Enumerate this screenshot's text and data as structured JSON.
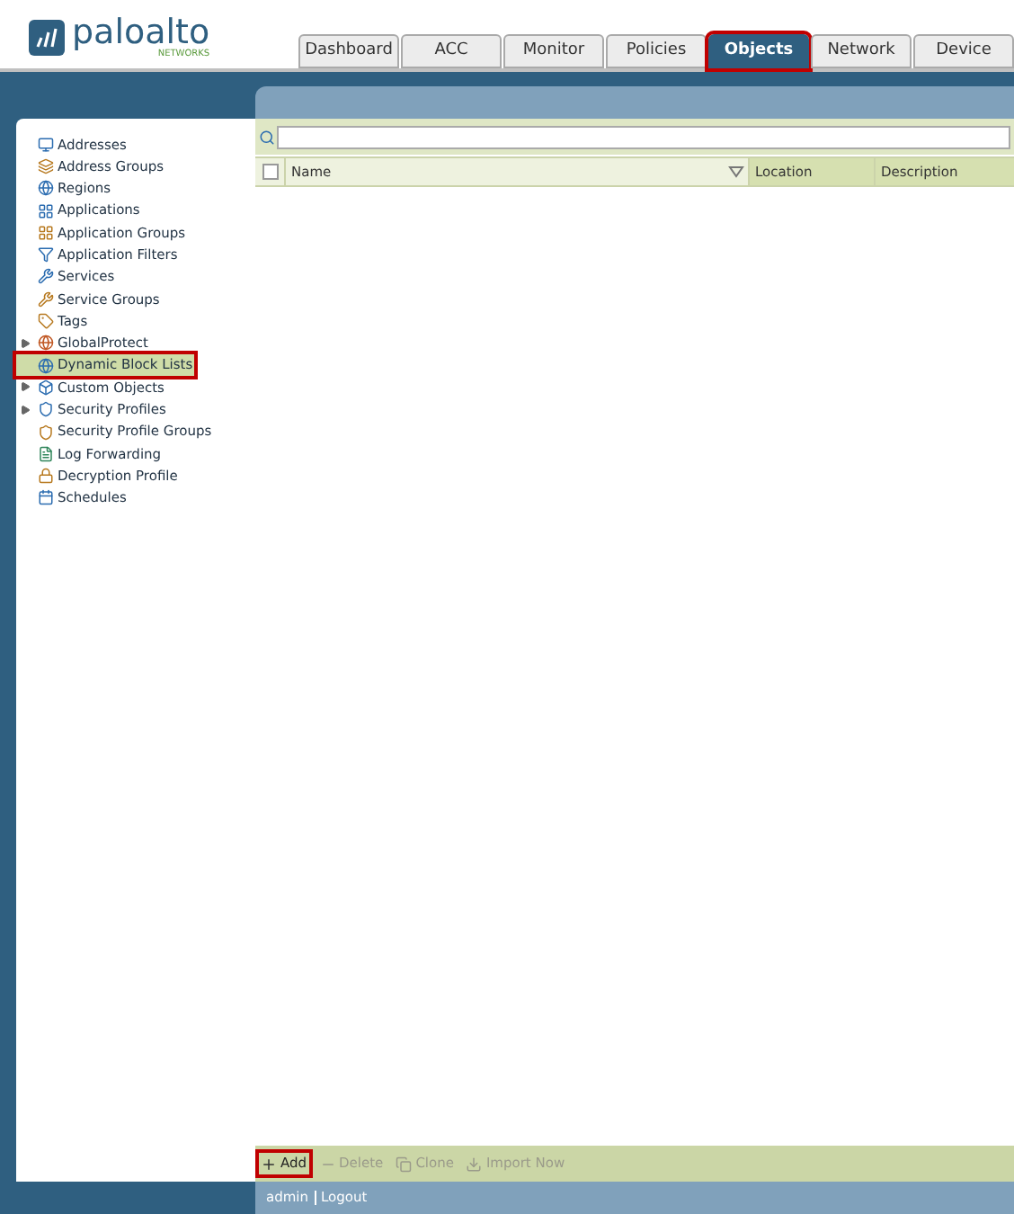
{
  "logo": {
    "name": "paloalto",
    "sub": "NETWORKS"
  },
  "tabs": [
    {
      "label": "Dashboard",
      "selected": false,
      "highlighted": false
    },
    {
      "label": "ACC",
      "selected": false,
      "highlighted": false
    },
    {
      "label": "Monitor",
      "selected": false,
      "highlighted": false
    },
    {
      "label": "Policies",
      "selected": false,
      "highlighted": false
    },
    {
      "label": "Objects",
      "selected": true,
      "highlighted": true
    },
    {
      "label": "Network",
      "selected": false,
      "highlighted": false
    },
    {
      "label": "Device",
      "selected": false,
      "highlighted": false
    }
  ],
  "sidebar": {
    "items": [
      {
        "label": "Addresses",
        "kind": "item",
        "selected": false,
        "highlighted": false
      },
      {
        "label": "Address Groups",
        "kind": "item",
        "selected": false,
        "highlighted": false
      },
      {
        "label": "Regions",
        "kind": "item",
        "selected": false,
        "highlighted": false
      },
      {
        "label": "Applications",
        "kind": "item",
        "selected": false,
        "highlighted": false
      },
      {
        "label": "Application Groups",
        "kind": "item",
        "selected": false,
        "highlighted": false
      },
      {
        "label": "Application Filters",
        "kind": "item",
        "selected": false,
        "highlighted": false
      },
      {
        "label": "Services",
        "kind": "item",
        "selected": false,
        "highlighted": false
      },
      {
        "label": "Service Groups",
        "kind": "item",
        "selected": false,
        "highlighted": false
      },
      {
        "label": "Tags",
        "kind": "item",
        "selected": false,
        "highlighted": false
      },
      {
        "label": "GlobalProtect",
        "kind": "folder",
        "expanded": false,
        "selected": false,
        "highlighted": false
      },
      {
        "label": "Dynamic Block Lists",
        "kind": "item",
        "selected": true,
        "highlighted": true
      },
      {
        "label": "Custom Objects",
        "kind": "folder",
        "expanded": false,
        "selected": false,
        "highlighted": false
      },
      {
        "label": "Security Profiles",
        "kind": "folder",
        "expanded": false,
        "selected": false,
        "highlighted": false
      },
      {
        "label": "Security Profile Groups",
        "kind": "item",
        "selected": false,
        "highlighted": false
      },
      {
        "label": "Log Forwarding",
        "kind": "item",
        "selected": false,
        "highlighted": false
      },
      {
        "label": "Decryption Profile",
        "kind": "item",
        "selected": false,
        "highlighted": false
      },
      {
        "label": "Schedules",
        "kind": "item",
        "selected": false,
        "highlighted": false
      }
    ]
  },
  "table": {
    "select_all": {
      "checked": false
    },
    "columns": [
      "Name",
      "Location",
      "Description"
    ]
  },
  "toolbar": [
    {
      "label": "Add",
      "disabled": false,
      "highlighted": true
    },
    {
      "label": "Delete",
      "disabled": true,
      "highlighted": false
    },
    {
      "label": "Clone",
      "disabled": true,
      "highlighted": false
    },
    {
      "label": "Import Now",
      "disabled": true,
      "highlighted": false
    }
  ],
  "footer": {
    "user": "admin",
    "logout": "Logout"
  }
}
